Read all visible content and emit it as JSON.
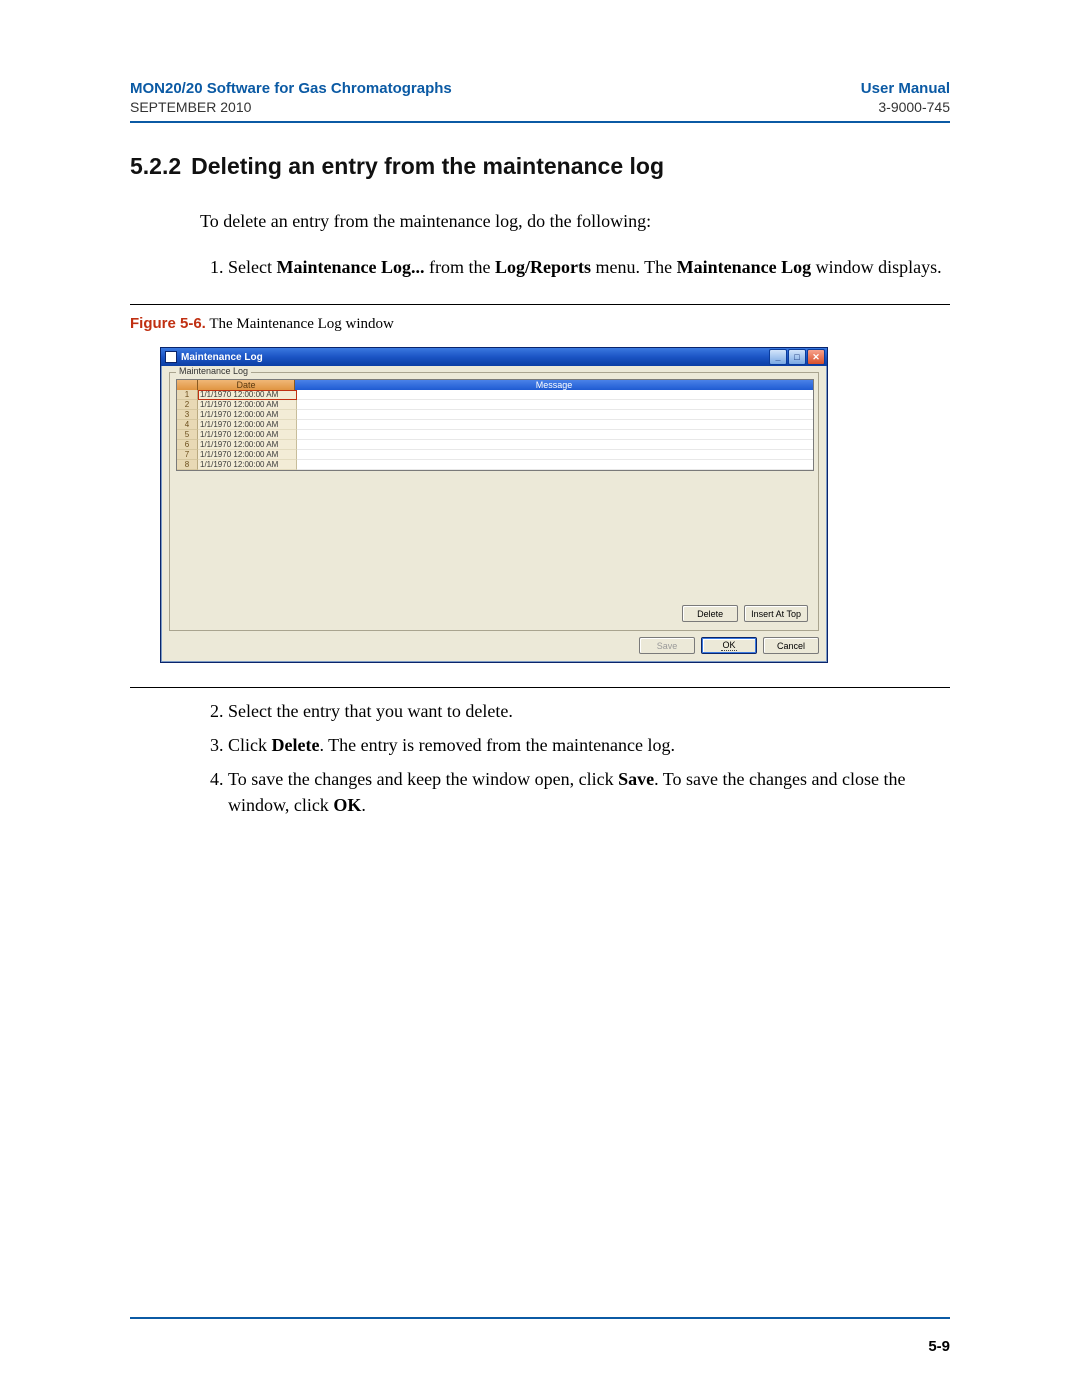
{
  "header": {
    "product": "MON20/20 Software for Gas Chromatographs",
    "manual": "User Manual",
    "date": "SEPTEMBER 2010",
    "docnum": "3-9000-745"
  },
  "section": {
    "number": "5.2.2",
    "title": "Deleting an entry from the maintenance log"
  },
  "intro": "To delete an entry from the maintenance log, do the following:",
  "step1": {
    "pre": "Select ",
    "b1": "Maintenance Log...",
    "mid1": " from the ",
    "b2": "Log/Reports",
    "mid2": " menu.  The ",
    "b3": "Maintenance Log",
    "post": " window displays."
  },
  "figure": {
    "label": "Figure 5-6.",
    "caption": "  The Maintenance Log window"
  },
  "window": {
    "title": "Maintenance Log",
    "group_label": "Maintenance Log",
    "columns": {
      "corner": "",
      "date": "Date",
      "message": "Message"
    },
    "rows": [
      {
        "n": "1",
        "date": "1/1/1970 12:00:00 AM",
        "msg": ""
      },
      {
        "n": "2",
        "date": "1/1/1970 12:00:00 AM",
        "msg": ""
      },
      {
        "n": "3",
        "date": "1/1/1970 12:00:00 AM",
        "msg": ""
      },
      {
        "n": "4",
        "date": "1/1/1970 12:00:00 AM",
        "msg": ""
      },
      {
        "n": "5",
        "date": "1/1/1970 12:00:00 AM",
        "msg": ""
      },
      {
        "n": "6",
        "date": "1/1/1970 12:00:00 AM",
        "msg": ""
      },
      {
        "n": "7",
        "date": "1/1/1970 12:00:00 AM",
        "msg": ""
      },
      {
        "n": "8",
        "date": "1/1/1970 12:00:00 AM",
        "msg": ""
      }
    ],
    "buttons": {
      "delete": "Delete",
      "insert_at_top": "Insert At Top",
      "save": "Save",
      "ok": "OK",
      "cancel": "Cancel"
    }
  },
  "steps_after": {
    "s2": "Select the entry that you want to delete.",
    "s3_pre": "Click ",
    "s3_b": "Delete",
    "s3_post": ".  The entry is removed from the maintenance log.",
    "s4_pre": "To save the changes and keep the window open, click ",
    "s4_b1": "Save",
    "s4_mid": ".  To save the changes and close the window, click ",
    "s4_b2": "OK",
    "s4_post": "."
  },
  "page_number": "5-9"
}
